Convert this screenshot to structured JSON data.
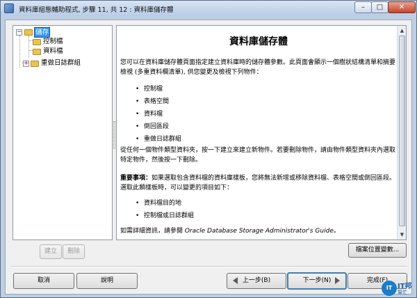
{
  "window": {
    "title": "資料庫組態輔助程式, 步驟 11, 共 12 : 資料庫儲存體",
    "minimize": "–",
    "maximize": "□",
    "close": "✕"
  },
  "tree": {
    "root": "儲存",
    "children": [
      "控制檔",
      "資料檔",
      "重做日誌群組"
    ]
  },
  "content": {
    "title": "資料庫儲存體",
    "intro": "您可以在資料庫儲存體頁面指定建立資料庫時的儲存體參數。此頁面會顯示一個樹狀結構清單和摘要檢視 (多重資料欄清單), 供您變更及檢視下列物件：",
    "objects": [
      "控制檔",
      "表格空間",
      "資料檔",
      "倒回區段",
      "重做日誌群組"
    ],
    "create_text": "從任何一個物件類型資料夾，按一下建立來建立新物件。若要刪除物件，請由物件類型資料夾內選取特定物件，然後按一下刪除。",
    "important_label": "重要事項：",
    "important_text": "如果選取包含資料檔的資料庫樣板，您將無法新增或移除資料檔、表格空間或倒回區段。選取此類樣板時，可以變更的項目如下：",
    "changeable": [
      "資料檔目的地",
      "控制檔或日誌群組"
    ],
    "more_info_prefix": "如需詳細資訊，請參閱 ",
    "more_info_link": "Oracle Database Storage Administrator's Guide",
    "more_info_suffix": "。"
  },
  "buttons": {
    "create": "建立",
    "delete": "刪除",
    "file_location": "檔案位置變數...",
    "cancel": "取消",
    "help": "說明",
    "back": "上一步(B)",
    "next": "下一步(N)",
    "finish": "完成(F)"
  },
  "watermark": {
    "badge": "IT",
    "line1": "IT邦",
    "line2": "幫忙"
  }
}
